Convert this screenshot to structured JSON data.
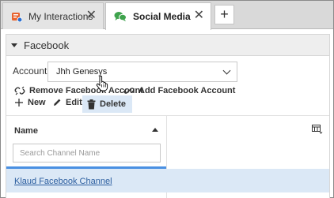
{
  "tabs": [
    {
      "label": "My Interactions",
      "icon": "my-interactions-icon"
    },
    {
      "label": "Social Media",
      "icon": "chat-bubbles-icon"
    }
  ],
  "tab_close_glyph": "✕",
  "tab_add_glyph": "+",
  "section": {
    "title": "Facebook"
  },
  "account": {
    "label": "Account:",
    "selected": "Jhh Genesys"
  },
  "actions": {
    "remove": "Remove Facebook Account",
    "add": "Add Facebook Account",
    "new": "New",
    "edit": "Edit",
    "delete": "Delete"
  },
  "grid": {
    "column_header": "Name",
    "search_placeholder": "Search Channel Name",
    "rows": [
      "Klaud Facebook Channel"
    ]
  },
  "colors": {
    "accent": "#4a90e2",
    "selected_row": "#dbe8f6",
    "link": "#2a5d9f",
    "social_green": "#3fa34d",
    "interactions_orange": "#e8632e"
  }
}
